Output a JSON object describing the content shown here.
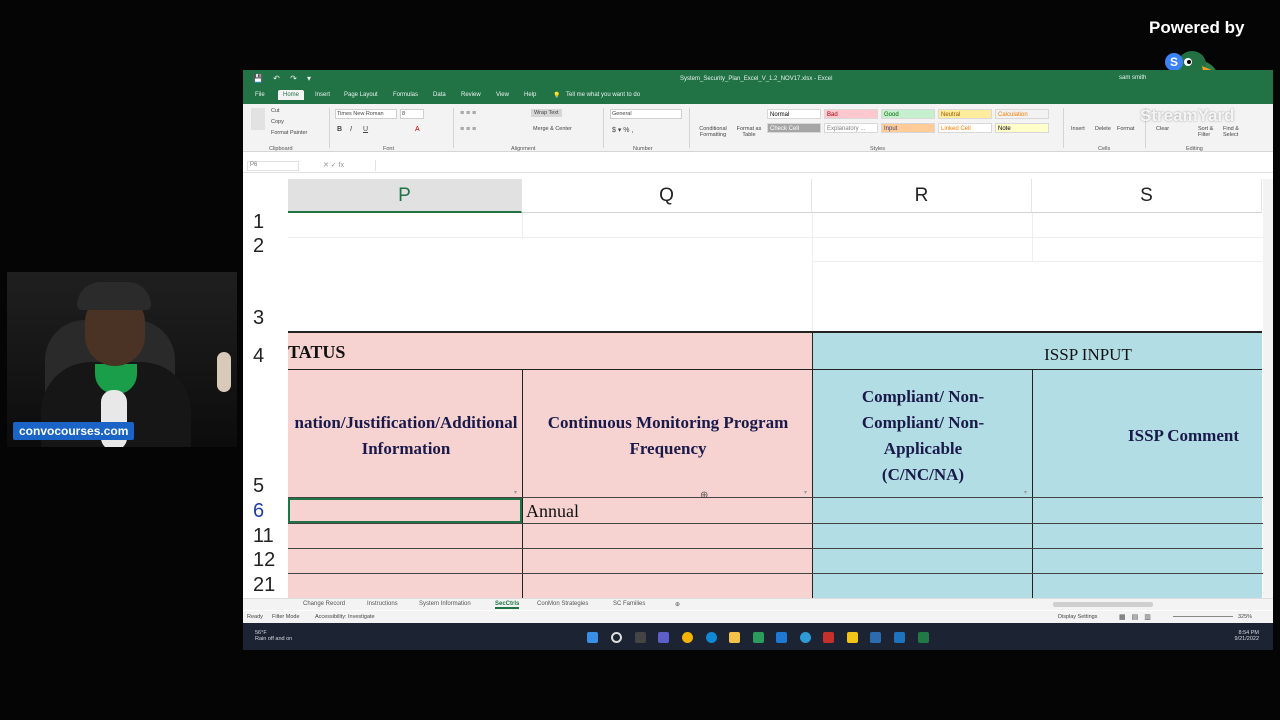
{
  "overlay": {
    "powered_by": "Powered by",
    "watermark": "convocourses.com",
    "streamyard_text": "StreamYard"
  },
  "excel": {
    "title": "System_Security_Plan_Excel_V_1.2_NOV17.xlsx - Excel",
    "user": "sam smith",
    "tabs": [
      "File",
      "Home",
      "Insert",
      "Page Layout",
      "Formulas",
      "Data",
      "Review",
      "View",
      "Help",
      "Tell me what you want to do"
    ],
    "active_tab": "Home",
    "ribbon": {
      "clipboard": {
        "cut": "Cut",
        "copy": "Copy",
        "format_painter": "Format Painter",
        "label": "Clipboard"
      },
      "font": {
        "name": "Times New Roman",
        "size": "8",
        "label": "Font"
      },
      "alignment": {
        "wrap_text": "Wrap Text",
        "merge_center": "Merge & Center",
        "label": "Alignment"
      },
      "number": {
        "format": "General",
        "label": "Number"
      },
      "styles": {
        "conditional_formatting": "Conditional Formatting",
        "format_as_table": "Format as Table",
        "cells": [
          {
            "label": "Normal",
            "bg": "#ffffff",
            "fg": "#000000"
          },
          {
            "label": "Bad",
            "bg": "#ffc7ce",
            "fg": "#9c0006"
          },
          {
            "label": "Good",
            "bg": "#c6efce",
            "fg": "#006100"
          },
          {
            "label": "Neutral",
            "bg": "#ffeb9c",
            "fg": "#9c5700"
          },
          {
            "label": "Calculation",
            "bg": "#f2f2f2",
            "fg": "#fa7d00"
          },
          {
            "label": "Check Cell",
            "bg": "#a5a5a5",
            "fg": "#ffffff"
          },
          {
            "label": "Explanatory ...",
            "bg": "#ffffff",
            "fg": "#7f7f7f"
          },
          {
            "label": "Input",
            "bg": "#ffcc99",
            "fg": "#3f3f76"
          },
          {
            "label": "Linked Cell",
            "bg": "#ffffff",
            "fg": "#fa7d00"
          },
          {
            "label": "Note",
            "bg": "#ffffcc",
            "fg": "#000000"
          }
        ],
        "label": "Styles"
      },
      "cells_group": {
        "insert": "Insert",
        "delete": "Delete",
        "format": "Format",
        "label": "Cells"
      },
      "editing": {
        "sort_filter": "Sort & Filter",
        "find_select": "Find & Select",
        "clear": "Clear",
        "label": "Editing"
      }
    },
    "name_box": "P6",
    "columns": [
      "P",
      "Q",
      "R",
      "S"
    ],
    "selected_column": "P",
    "rows": [
      "1",
      "2",
      "3",
      "4",
      "5",
      "6",
      "11",
      "12",
      "21"
    ],
    "selected_row": "6",
    "headers": {
      "status_group": "TATUS",
      "issp_group": "ISSP INPUT",
      "p_header": "nation/Justification/Additional Information",
      "q_header": "Continuous Monitoring Program Frequency",
      "r_header": "Compliant/ Non-Compliant/ Non-Applicable (C/NC/NA)",
      "s_header": "ISSP Comment"
    },
    "cell_q6": "Annual",
    "sheets": [
      "Change Record",
      "Instructions",
      "System Information",
      "SecCtrls",
      "ConMon Strategies",
      "SC Families"
    ],
    "active_sheet": "SecCtrls",
    "status": {
      "ready": "Ready",
      "filter_mode": "Filter Mode",
      "accessibility": "Accessibility: Investigate",
      "display_settings": "Display Settings",
      "zoom": "325%"
    },
    "taskbar": {
      "weather_temp": "56°F",
      "weather_desc": "Rain off and on",
      "time": "8:54 PM",
      "date": "9/21/2022"
    },
    "colors": {
      "excel_green": "#217346",
      "status_pink": "#f6d3d1",
      "issp_blue": "#b3dde4"
    }
  }
}
